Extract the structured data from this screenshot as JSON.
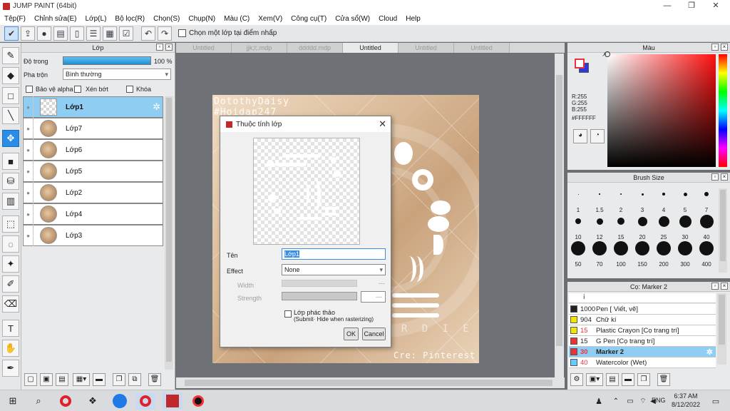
{
  "window": {
    "title": "JUMP PAINT (64bit)",
    "minimize": "—",
    "restore": "❐",
    "close": "✕"
  },
  "menu": [
    "Tệp(F)",
    "Chỉnh sửa(E)",
    "Lớp(L)",
    "Bộ lọc(R)",
    "Chọn(S)",
    "Chụp(N)",
    "Màu (C)",
    "Xem(V)",
    "Công cụ(T)",
    "Cửa sổ(W)",
    "Cloud",
    "Help"
  ],
  "toolbar": {
    "pick_layer_label": "Chọn một lớp tại điểm nhấp"
  },
  "layer_panel": {
    "title": "Lớp",
    "opacity_label": "Độ trong",
    "opacity_value": "100 %",
    "opacity_percent": 100,
    "blend_label": "Pha trộn",
    "blend_value": "Bình thường",
    "protect_alpha": "Bảo vệ alpha",
    "clipping": "Xén bớt",
    "lock": "Khóa",
    "layers": [
      {
        "name": "Lớp1",
        "selected": true
      },
      {
        "name": "Lớp7",
        "selected": false
      },
      {
        "name": "Lớp6",
        "selected": false
      },
      {
        "name": "Lớp5",
        "selected": false
      },
      {
        "name": "Lớp2",
        "selected": false
      },
      {
        "name": "Lớp4",
        "selected": false
      },
      {
        "name": "Lớp3",
        "selected": false
      }
    ]
  },
  "doc_tabs": [
    "Untitled",
    "jjk;l;.mdp",
    "ddddd.mdp",
    "Untitled",
    "Untitled",
    "Untitled"
  ],
  "artwork": {
    "watermark_top": "DotothyDaisy",
    "hashtag": "#Hoidap247",
    "credit": "Cre: Pinterest",
    "faint_text": "A R D I E"
  },
  "dialog": {
    "title": "Thuộc tính lớp",
    "name_label": "Tên",
    "name_value": "Lớp1",
    "effect_label": "Effect",
    "effect_value": "None",
    "width_label": "Width",
    "width_value": "---",
    "strength_label": "Strength",
    "strength_value": "---",
    "draft_label": "Lớp phác thảo",
    "draft_sub": "(Submit· Hide when rasterizing)",
    "ok": "OK",
    "cancel": "Cancel"
  },
  "color_panel": {
    "title": "Màu",
    "r": "R:255",
    "g": "G:255",
    "b": "B:255",
    "hex": "#FFFFFF"
  },
  "brush_panel": {
    "title": "Brush Size",
    "sizes": [
      "1",
      "1.5",
      "2",
      "3",
      "4",
      "5",
      "7",
      "10",
      "12",
      "15",
      "20",
      "25",
      "30",
      "40",
      "50",
      "70",
      "100",
      "150",
      "200",
      "300",
      "400"
    ]
  },
  "marker_panel": {
    "title": "Cọ: Marker 2",
    "brushes": [
      {
        "size": "1000",
        "name": "Pen [ Viết, vẽ]",
        "color": "#222222",
        "selected": false,
        "red": false
      },
      {
        "size": "904",
        "name": "Chữ kí",
        "color": "#f2e600",
        "selected": false,
        "red": false
      },
      {
        "size": "15",
        "name": "Plastic Crayon [Cọ trang trí]",
        "color": "#f2e600",
        "selected": false,
        "red": true
      },
      {
        "size": "15",
        "name": "G Pen [Cọ trang trí]",
        "color": "#e8333a",
        "selected": false,
        "red": false
      },
      {
        "size": "30",
        "name": "Marker 2",
        "color": "#e8333a",
        "selected": true,
        "red": true
      },
      {
        "size": "40",
        "name": "Watercolor (Wet)",
        "color": "#66ccff",
        "selected": false,
        "red": true
      }
    ]
  },
  "taskbar": {
    "time": "6:37 AM",
    "date": "8/12/2022",
    "lang": "ENG"
  }
}
